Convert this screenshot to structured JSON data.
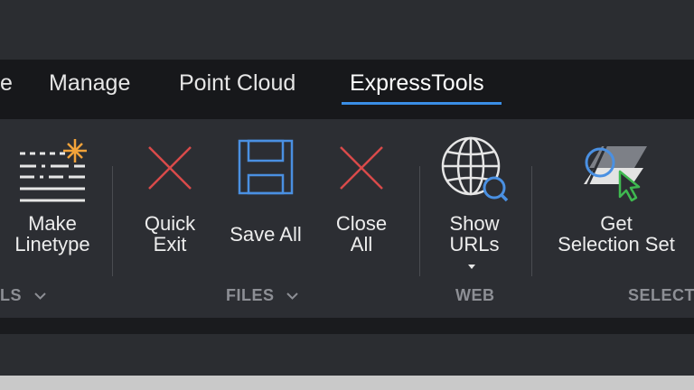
{
  "tabs": [
    {
      "label": "e",
      "active": false
    },
    {
      "label": "Manage",
      "active": false
    },
    {
      "label": "Point Cloud",
      "active": false
    },
    {
      "label": "ExpressTools",
      "active": true
    }
  ],
  "tools": {
    "make_linetype": {
      "label": "Make\nLinetype",
      "icon": "linetype-icon"
    },
    "quick_exit": {
      "label": "Quick\nExit",
      "icon": "close-x-icon"
    },
    "save_all": {
      "label": "Save All",
      "icon": "save-disk-icon"
    },
    "close_all": {
      "label": "Close\nAll",
      "icon": "close-x-icon"
    },
    "show_urls": {
      "label": "Show\nURLs",
      "icon": "globe-search-icon"
    },
    "get_selection_set": {
      "label": "Get\nSelection Set",
      "icon": "selection-set-icon"
    }
  },
  "panels": {
    "tools_label": "LS",
    "files_label": "FILES",
    "web_label": "WEB",
    "select_label": "SELECT"
  },
  "colors": {
    "accent": "#3a8ee6",
    "close_x": "#d94a4a",
    "save_icon": "#4a90e2",
    "cursor_green": "#3fb950",
    "spark_orange": "#f2a33a"
  }
}
